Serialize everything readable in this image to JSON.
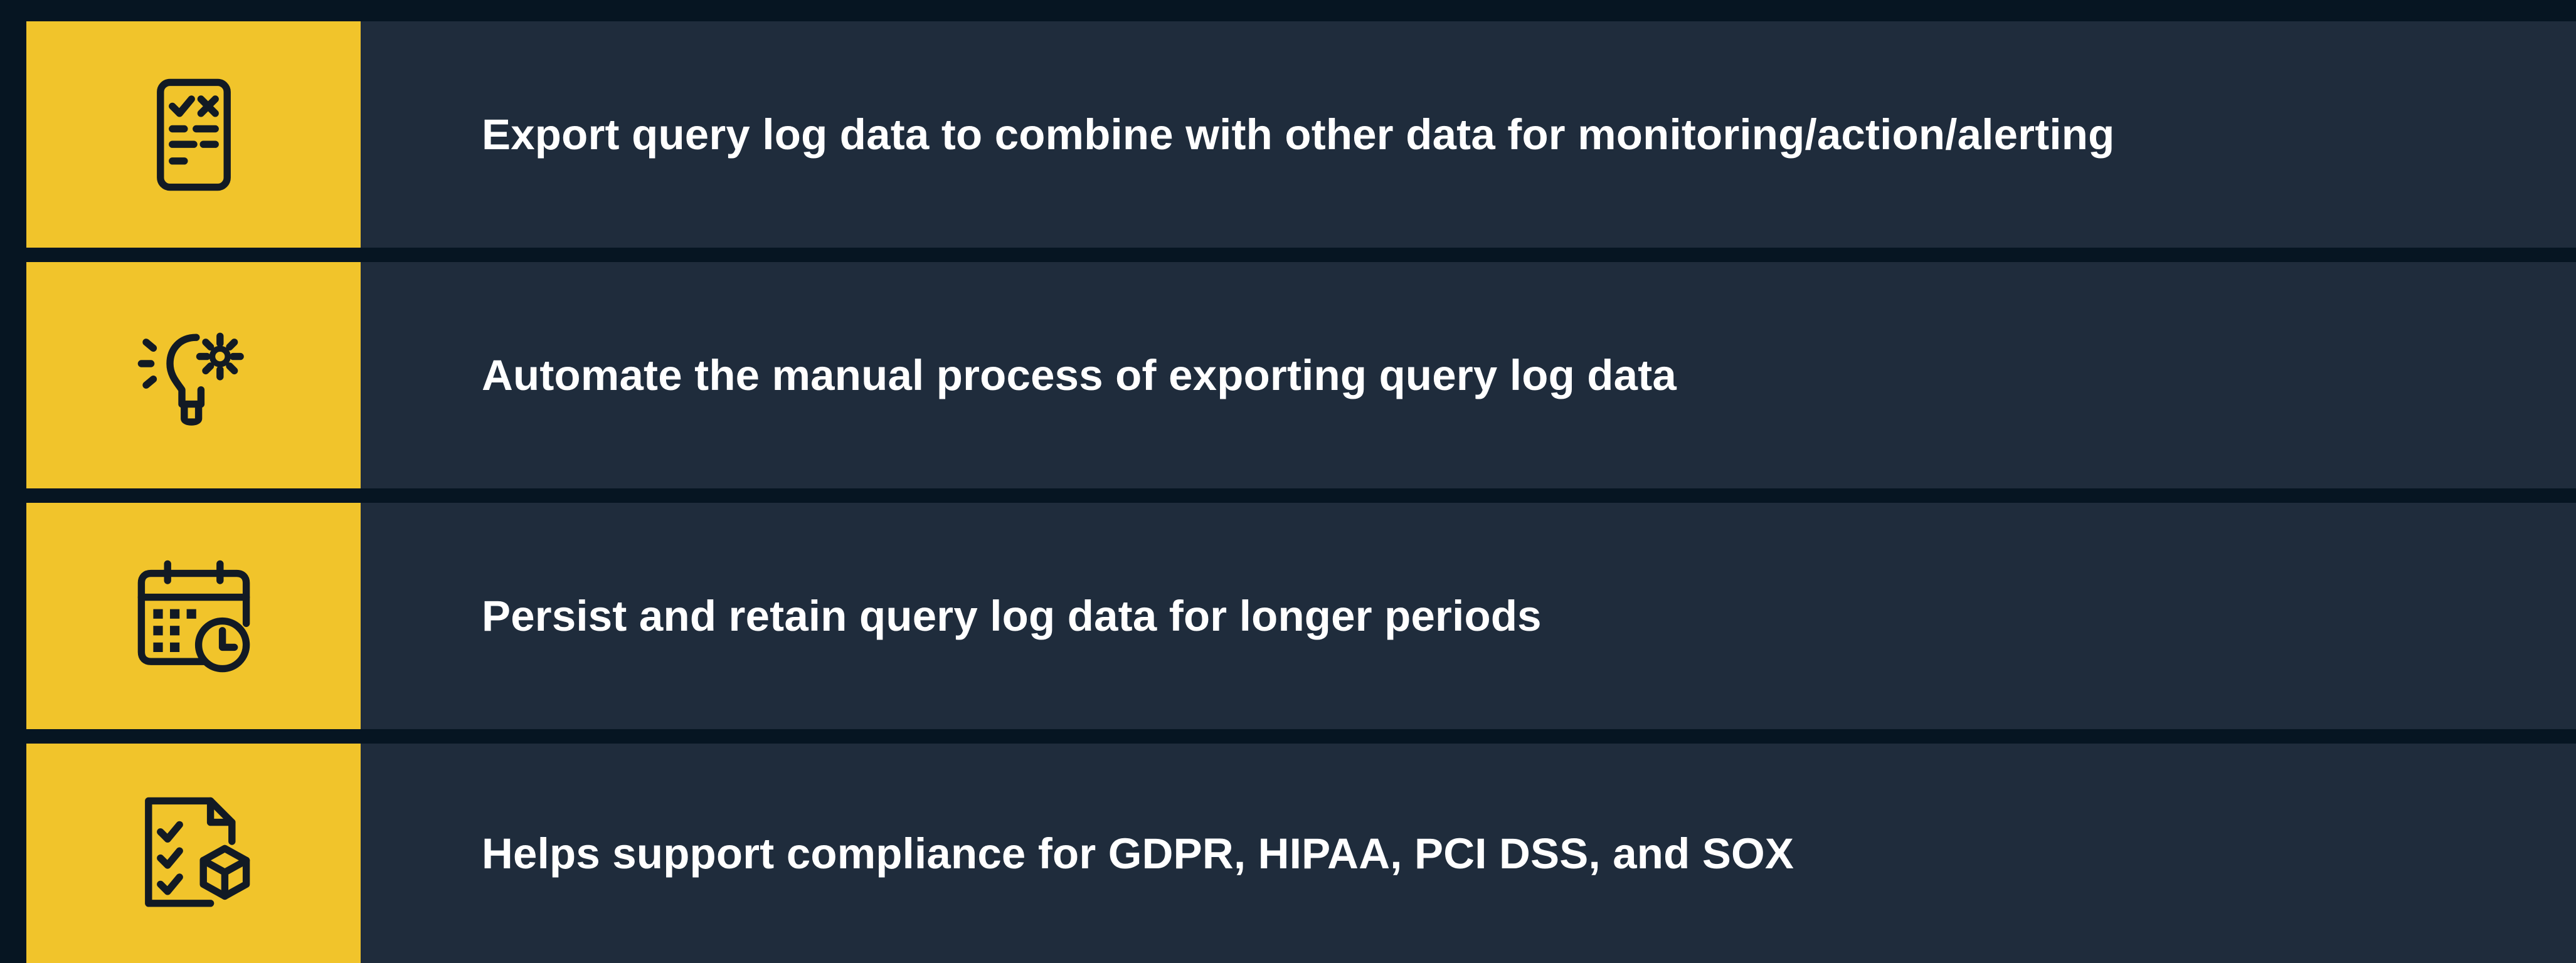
{
  "colors": {
    "background": "#061522",
    "row_background": "#1f2c3c",
    "accent": "#f1c42b",
    "text": "#ffffff",
    "icon_stroke": "#121a24"
  },
  "items": [
    {
      "icon": "checklist-document-icon",
      "text": "Export query log data to combine with other data for monitoring/action/alerting"
    },
    {
      "icon": "lightbulb-gear-icon",
      "text": "Automate the manual process of exporting query log data"
    },
    {
      "icon": "calendar-clock-icon",
      "text": "Persist and retain query log data for longer periods"
    },
    {
      "icon": "compliance-checklist-icon",
      "text": "Helps support compliance for GDPR, HIPAA, PCI DSS, and SOX"
    }
  ]
}
